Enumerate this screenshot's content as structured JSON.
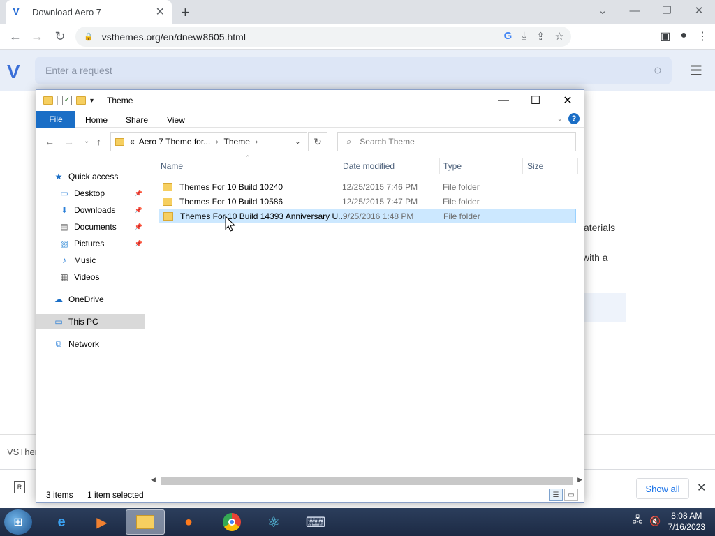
{
  "browser": {
    "tab_title": "Download Aero 7",
    "tab_favicon": "V",
    "url": "vsthemes.org/en/dnew/8605.html"
  },
  "website": {
    "search_placeholder": "Enter a request",
    "bg_text_1": "aterials",
    "bg_text_2": "with a",
    "footer_text": "VSTher",
    "show_all": "Show all"
  },
  "explorer": {
    "title": "Theme",
    "ribbon_tabs": [
      "File",
      "Home",
      "Share",
      "View"
    ],
    "breadcrumb": {
      "prefix": "«",
      "parent": "Aero 7 Theme for...",
      "current": "Theme"
    },
    "search_placeholder": "Search Theme",
    "columns": [
      "Name",
      "Date modified",
      "Type",
      "Size"
    ],
    "nav": {
      "quick_access": "Quick access",
      "desktop": "Desktop",
      "downloads": "Downloads",
      "documents": "Documents",
      "pictures": "Pictures",
      "music": "Music",
      "videos": "Videos",
      "onedrive": "OneDrive",
      "this_pc": "This PC",
      "network": "Network"
    },
    "files": [
      {
        "name": "Themes For 10 Build 10240",
        "date": "12/25/2015 7:46 PM",
        "type": "File folder"
      },
      {
        "name": "Themes For 10 Build 10586",
        "date": "12/25/2015 7:47 PM",
        "type": "File folder"
      },
      {
        "name": "Themes For 10 Build 14393 Anniversary U...",
        "date": "9/25/2016 1:48 PM",
        "type": "File folder"
      }
    ],
    "status_items": "3 items",
    "status_selected": "1 item selected"
  },
  "taskbar": {
    "time": "8:08 AM",
    "date": "7/16/2023"
  },
  "colors": {
    "explorer_accent": "#1a6ec6",
    "selection": "#cce8ff",
    "folder": "#f6cf60",
    "taskbar": "#1c2a44"
  }
}
